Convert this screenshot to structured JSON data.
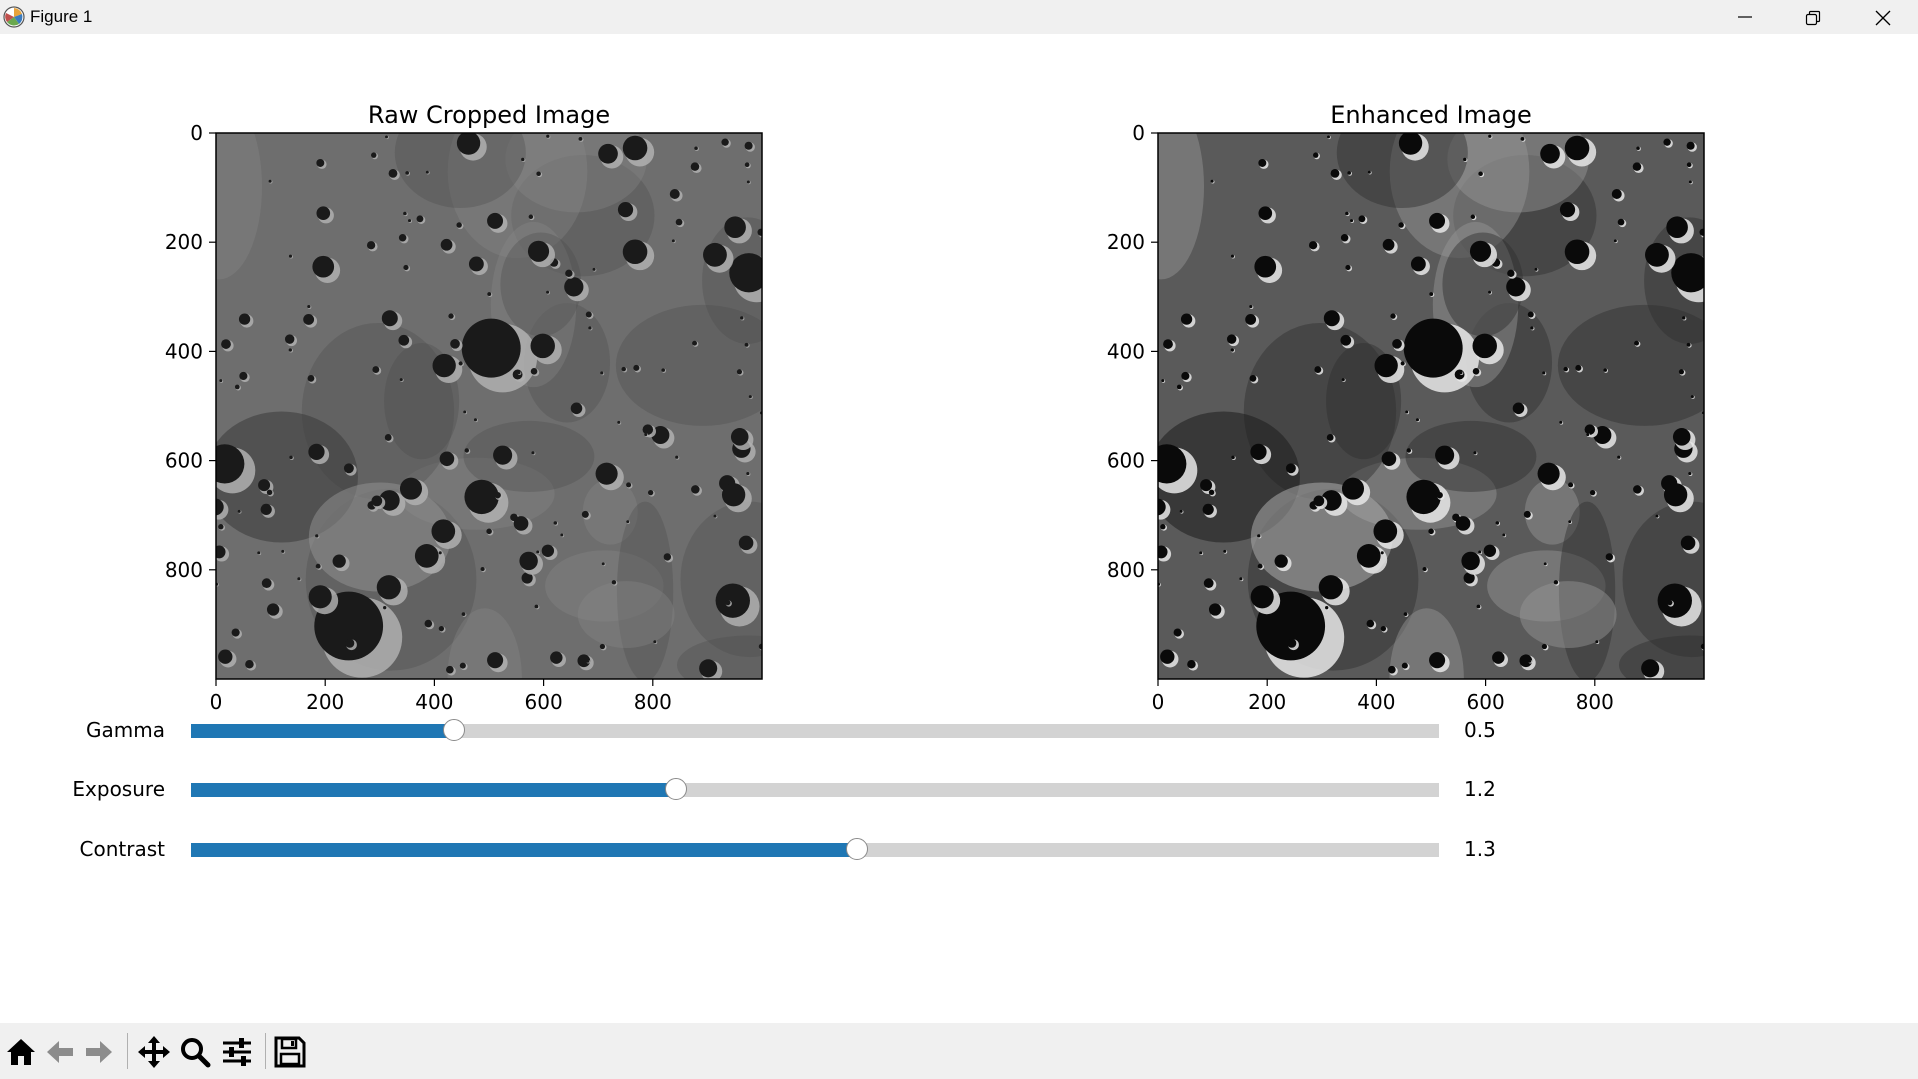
{
  "window": {
    "title": "Figure 1",
    "icons": {
      "app": "matplotlib-icon",
      "minimize": "minimize-icon",
      "restore": "restore-icon",
      "close": "close-icon"
    }
  },
  "figure": {
    "panels": [
      {
        "title": "Raw Cropped Image",
        "xticks": [
          "0",
          "200",
          "400",
          "600",
          "800"
        ],
        "yticks": [
          "0",
          "200",
          "400",
          "600",
          "800"
        ],
        "image_extent": [
          0,
          1000
        ],
        "style": "raw"
      },
      {
        "title": "Enhanced Image",
        "xticks": [
          "0",
          "200",
          "400",
          "600",
          "800"
        ],
        "yticks": [
          "0",
          "200",
          "400",
          "600",
          "800"
        ],
        "image_extent": [
          0,
          1000
        ],
        "style": "enhanced"
      }
    ],
    "sliders": [
      {
        "label": "Gamma",
        "value": 0.5,
        "value_text": "0.5",
        "min": 0.1,
        "max": 2.0
      },
      {
        "label": "Exposure",
        "value": 1.2,
        "value_text": "1.2",
        "min": 0.5,
        "max": 2.3
      },
      {
        "label": "Contrast",
        "value": 1.3,
        "value_text": "1.3",
        "min": 0.5,
        "max": 2.0
      }
    ],
    "colors": {
      "slider_fill": "#1f77b4",
      "slider_track": "#d3d3d3"
    }
  },
  "toolbar": {
    "buttons": [
      {
        "name": "home-button",
        "icon": "home-icon"
      },
      {
        "name": "back-button",
        "icon": "arrow-left-icon"
      },
      {
        "name": "forward-button",
        "icon": "arrow-right-icon"
      },
      {
        "name": "pan-button",
        "icon": "move-icon"
      },
      {
        "name": "zoom-button",
        "icon": "magnifier-icon"
      },
      {
        "name": "configure-subplots-button",
        "icon": "sliders-icon"
      },
      {
        "name": "save-button",
        "icon": "floppy-disk-icon"
      }
    ]
  }
}
